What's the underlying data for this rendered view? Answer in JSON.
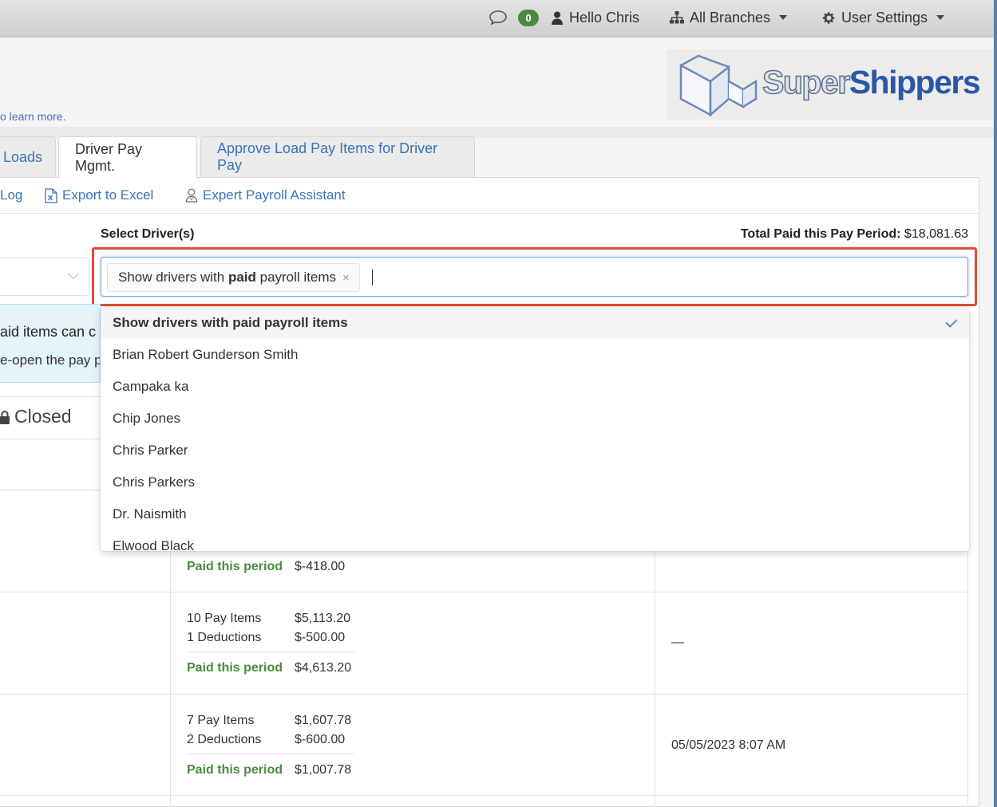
{
  "topbar": {
    "message_count": "0",
    "greeting": "Hello Chris",
    "branches_label": "All Branches",
    "settings_label": "User Settings"
  },
  "header": {
    "learn_more_text": "o learn more.",
    "logo_super": "Super",
    "logo_shippers": "Shippers"
  },
  "tabs": [
    {
      "label": "Loads"
    },
    {
      "label": "Driver Pay Mgmt."
    },
    {
      "label": "Approve Load Pay Items for Driver Pay"
    }
  ],
  "toolbar": {
    "log_label": "Log",
    "export_label": "Export to Excel",
    "expert_label": "Expert Payroll Assistant"
  },
  "filter": {
    "select_label": "Select Driver(s)",
    "total_label": "Total Paid this Pay Period:",
    "total_value": "$18,081.63",
    "chip_prefix": "Show drivers with ",
    "chip_bold": "paid",
    "chip_suffix": " payroll items",
    "chip_remove": "×"
  },
  "info": {
    "line1": "aid items can c",
    "line2": "e-open the pay p"
  },
  "status": {
    "closed_label": "Closed"
  },
  "dropdown": {
    "options": [
      {
        "label": "Show drivers with paid payroll items",
        "selected": true
      },
      {
        "label": "Brian Robert Gunderson Smith",
        "selected": false
      },
      {
        "label": "Campaka ka",
        "selected": false
      },
      {
        "label": "Chip Jones",
        "selected": false
      },
      {
        "label": "Chris Parker",
        "selected": false
      },
      {
        "label": "Chris Parkers",
        "selected": false
      },
      {
        "label": "Dr. Naismith",
        "selected": false
      },
      {
        "label": "Elwood Black",
        "selected": false
      }
    ]
  },
  "rows": [
    {
      "paid_label": "Paid this period",
      "paid_value": "$-418.00"
    },
    {
      "pay_items": "10 Pay Items",
      "pay_items_value": "$5,113.20",
      "deductions": "1 Deductions",
      "deductions_value": "$-500.00",
      "paid_label": "Paid this period",
      "paid_value": "$4,613.20",
      "date": "—"
    },
    {
      "pay_items": "7 Pay Items",
      "pay_items_value": "$1,607.78",
      "deductions": "2 Deductions",
      "deductions_value": "$-600.00",
      "paid_label": "Paid this period",
      "paid_value": "$1,007.78",
      "date": "05/05/2023 8:07 AM"
    }
  ],
  "colors": {
    "accent_link": "#3b73b9",
    "paid_green": "#4a8a3f",
    "highlight_red": "#e24a36",
    "badge_green": "#4a8a3f"
  }
}
